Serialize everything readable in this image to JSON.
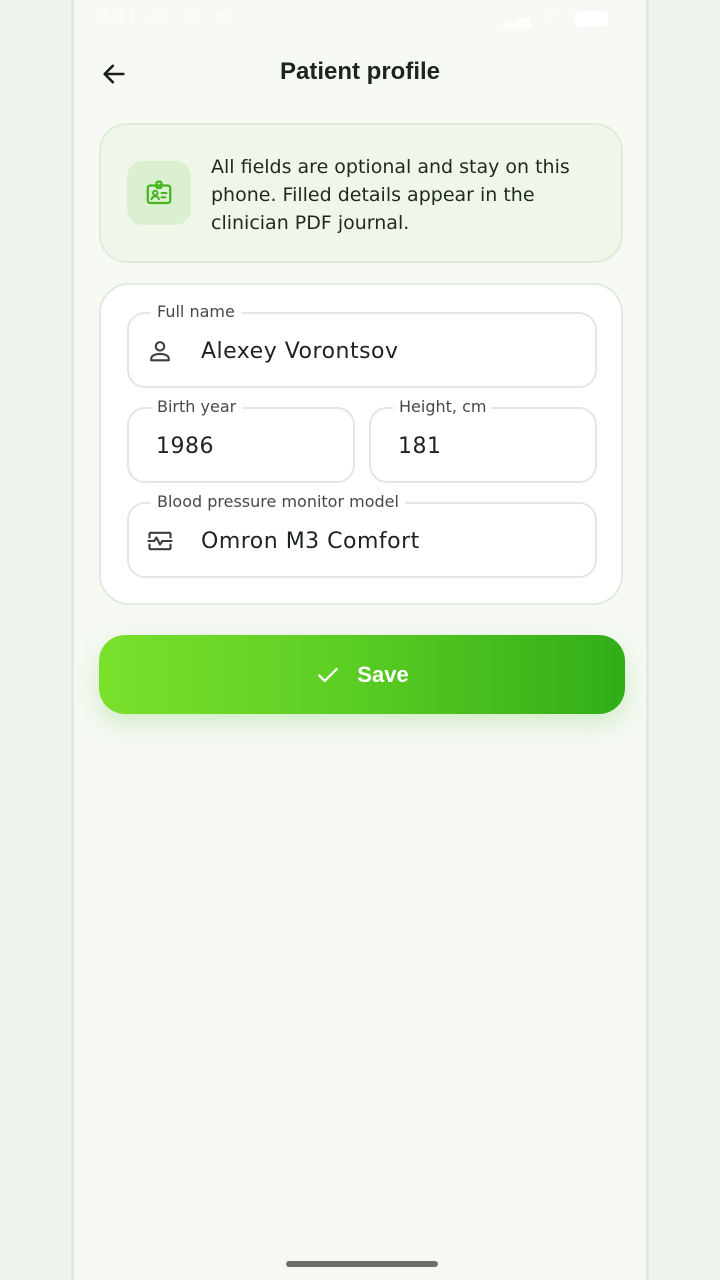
{
  "status_bar": {
    "time": "3:11",
    "left_icons": [
      "sync-icon",
      "do-not-disturb-icon",
      "target-icon"
    ],
    "right_icons": [
      "signal-icon",
      "wifi-icon",
      "battery-icon"
    ]
  },
  "header": {
    "title": "Patient profile",
    "back_icon": "arrow-left-icon"
  },
  "info_card": {
    "icon": "id-badge-icon",
    "text": "All fields are optional and stay on this phone. Filled details appear in the clinician PDF journal."
  },
  "form": {
    "full_name": {
      "label": "Full name",
      "value": "Alexey Vorontsov",
      "icon": "person-icon"
    },
    "birth_year": {
      "label": "Birth year",
      "value": "1986"
    },
    "height": {
      "label": "Height, cm",
      "value": "181"
    },
    "monitor_model": {
      "label": "Blood pressure monitor model",
      "value": "Omron M3 Comfort",
      "icon": "pulse-monitor-icon"
    }
  },
  "save_button": {
    "label": "Save",
    "icon": "check-icon"
  },
  "colors": {
    "accent": "#5dcf24",
    "accent_dark": "#31ad18",
    "accent_light": "#7ae02c",
    "card_tint": "#eef7ea",
    "background": "#f6f9f4"
  }
}
